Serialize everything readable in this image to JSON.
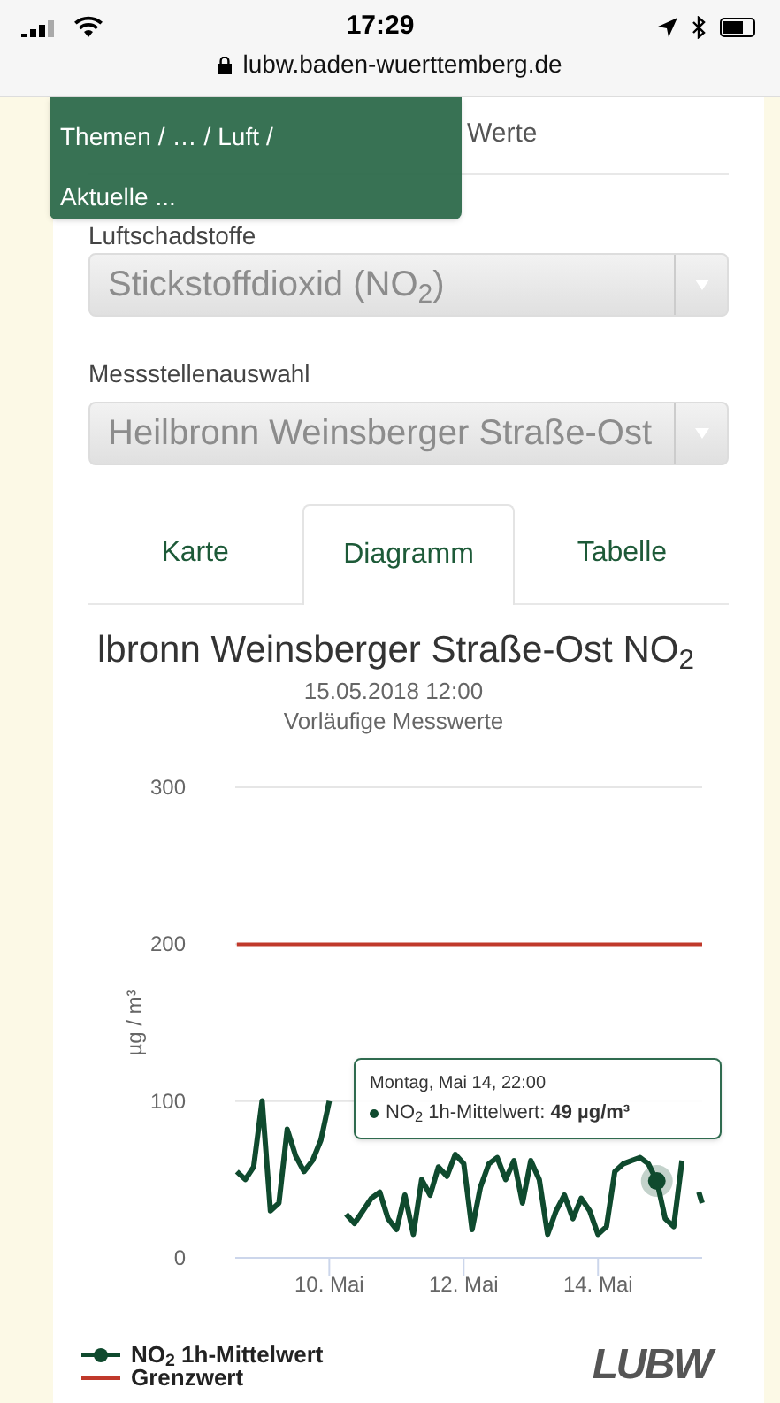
{
  "status_bar": {
    "time": "17:29",
    "url": "lubw.baden-wuerttemberg.de"
  },
  "breadcrumb": {
    "items": [
      "Themen",
      "/",
      "…",
      "/",
      "Luft",
      "/"
    ],
    "current": "Aktuelle ..."
  },
  "heading_fragment": "Werte",
  "pollutant": {
    "label": "Luftschadstoffe",
    "value": "Stickstoffdioxid (NO$_{2}$)",
    "disabled": true
  },
  "station": {
    "label": "Messstellenauswahl",
    "value": "Heilbronn Weinsberger Straße-Ost",
    "disabled": true
  },
  "tabs": [
    {
      "label": "Karte",
      "selected": false
    },
    {
      "label": "Diagramm",
      "selected": true
    },
    {
      "label": "Tabelle",
      "selected": false
    }
  ],
  "chart": {
    "title": "lbronn Weinsberger Straße-Ost NO$_{2}$",
    "subtitle": "15.05.2018 12:00",
    "caption": "Vorläufige Messwerte",
    "tooltip": {
      "title": "Montag, Mai 14, 22:00",
      "text": "NO$_{2}$ 1h-Mittelwert: **49 µg/m³**"
    },
    "legend": [
      {
        "kind": "marker-line"
      },
      {
        "kind": "line"
      }
    ],
    "logo": "LUBW",
    "chart_data": {
      "type": "line",
      "ylabel": "µg / m³",
      "ylim": [
        0,
        300
      ],
      "yticks": [
        0,
        100,
        200,
        300
      ],
      "xlim": [
        8.6,
        15.55
      ],
      "xticks": [
        {
          "value": 10,
          "label": "10. Mai"
        },
        {
          "value": 12,
          "label": "12. Mai"
        },
        {
          "value": 14,
          "label": "14. Mai"
        }
      ],
      "x": [
        8.625,
        8.75,
        8.875,
        9.0,
        9.125,
        9.25,
        9.375,
        9.5,
        9.625,
        9.75,
        9.875,
        10.0,
        10.125,
        10.25,
        10.375,
        10.5,
        10.625,
        10.75,
        10.875,
        11.0,
        11.125,
        11.25,
        11.375,
        11.5,
        11.625,
        11.75,
        11.875,
        12.0,
        12.125,
        12.25,
        12.375,
        12.5,
        12.625,
        12.75,
        12.875,
        13.0,
        13.125,
        13.25,
        13.375,
        13.5,
        13.625,
        13.75,
        13.875,
        14.0,
        14.125,
        14.25,
        14.375,
        14.5,
        14.625,
        14.75,
        14.875,
        15.0,
        15.125,
        15.25,
        15.375,
        15.5,
        15.55
      ],
      "series": [
        {
          "name": "NO$_{2}$ 1h-Mittelwert",
          "color": "#0f4a2e",
          "values": [
            55,
            50,
            58,
            100,
            30,
            35,
            82,
            65,
            55,
            62,
            75,
            100,
            null,
            28,
            22,
            30,
            38,
            42,
            25,
            18,
            40,
            15,
            50,
            40,
            58,
            52,
            66,
            60,
            18,
            45,
            60,
            64,
            50,
            62,
            35,
            62,
            50,
            15,
            30,
            40,
            25,
            38,
            30,
            15,
            20,
            55,
            60,
            62,
            64,
            60,
            49,
            25,
            20,
            62,
            null,
            42,
            35
          ]
        },
        {
          "name": "Grenzwert",
          "color": "#c0392b",
          "values": [
            200,
            200,
            200,
            200,
            200,
            200,
            200,
            200,
            200,
            200,
            200,
            200,
            200,
            200,
            200,
            200,
            200,
            200,
            200,
            200,
            200,
            200,
            200,
            200,
            200,
            200,
            200,
            200,
            200,
            200,
            200,
            200,
            200,
            200,
            200,
            200,
            200,
            200,
            200,
            200,
            200,
            200,
            200,
            200,
            200,
            200,
            200,
            200,
            200,
            200,
            200,
            200,
            200,
            200,
            200,
            200,
            200
          ]
        }
      ]
    }
  }
}
